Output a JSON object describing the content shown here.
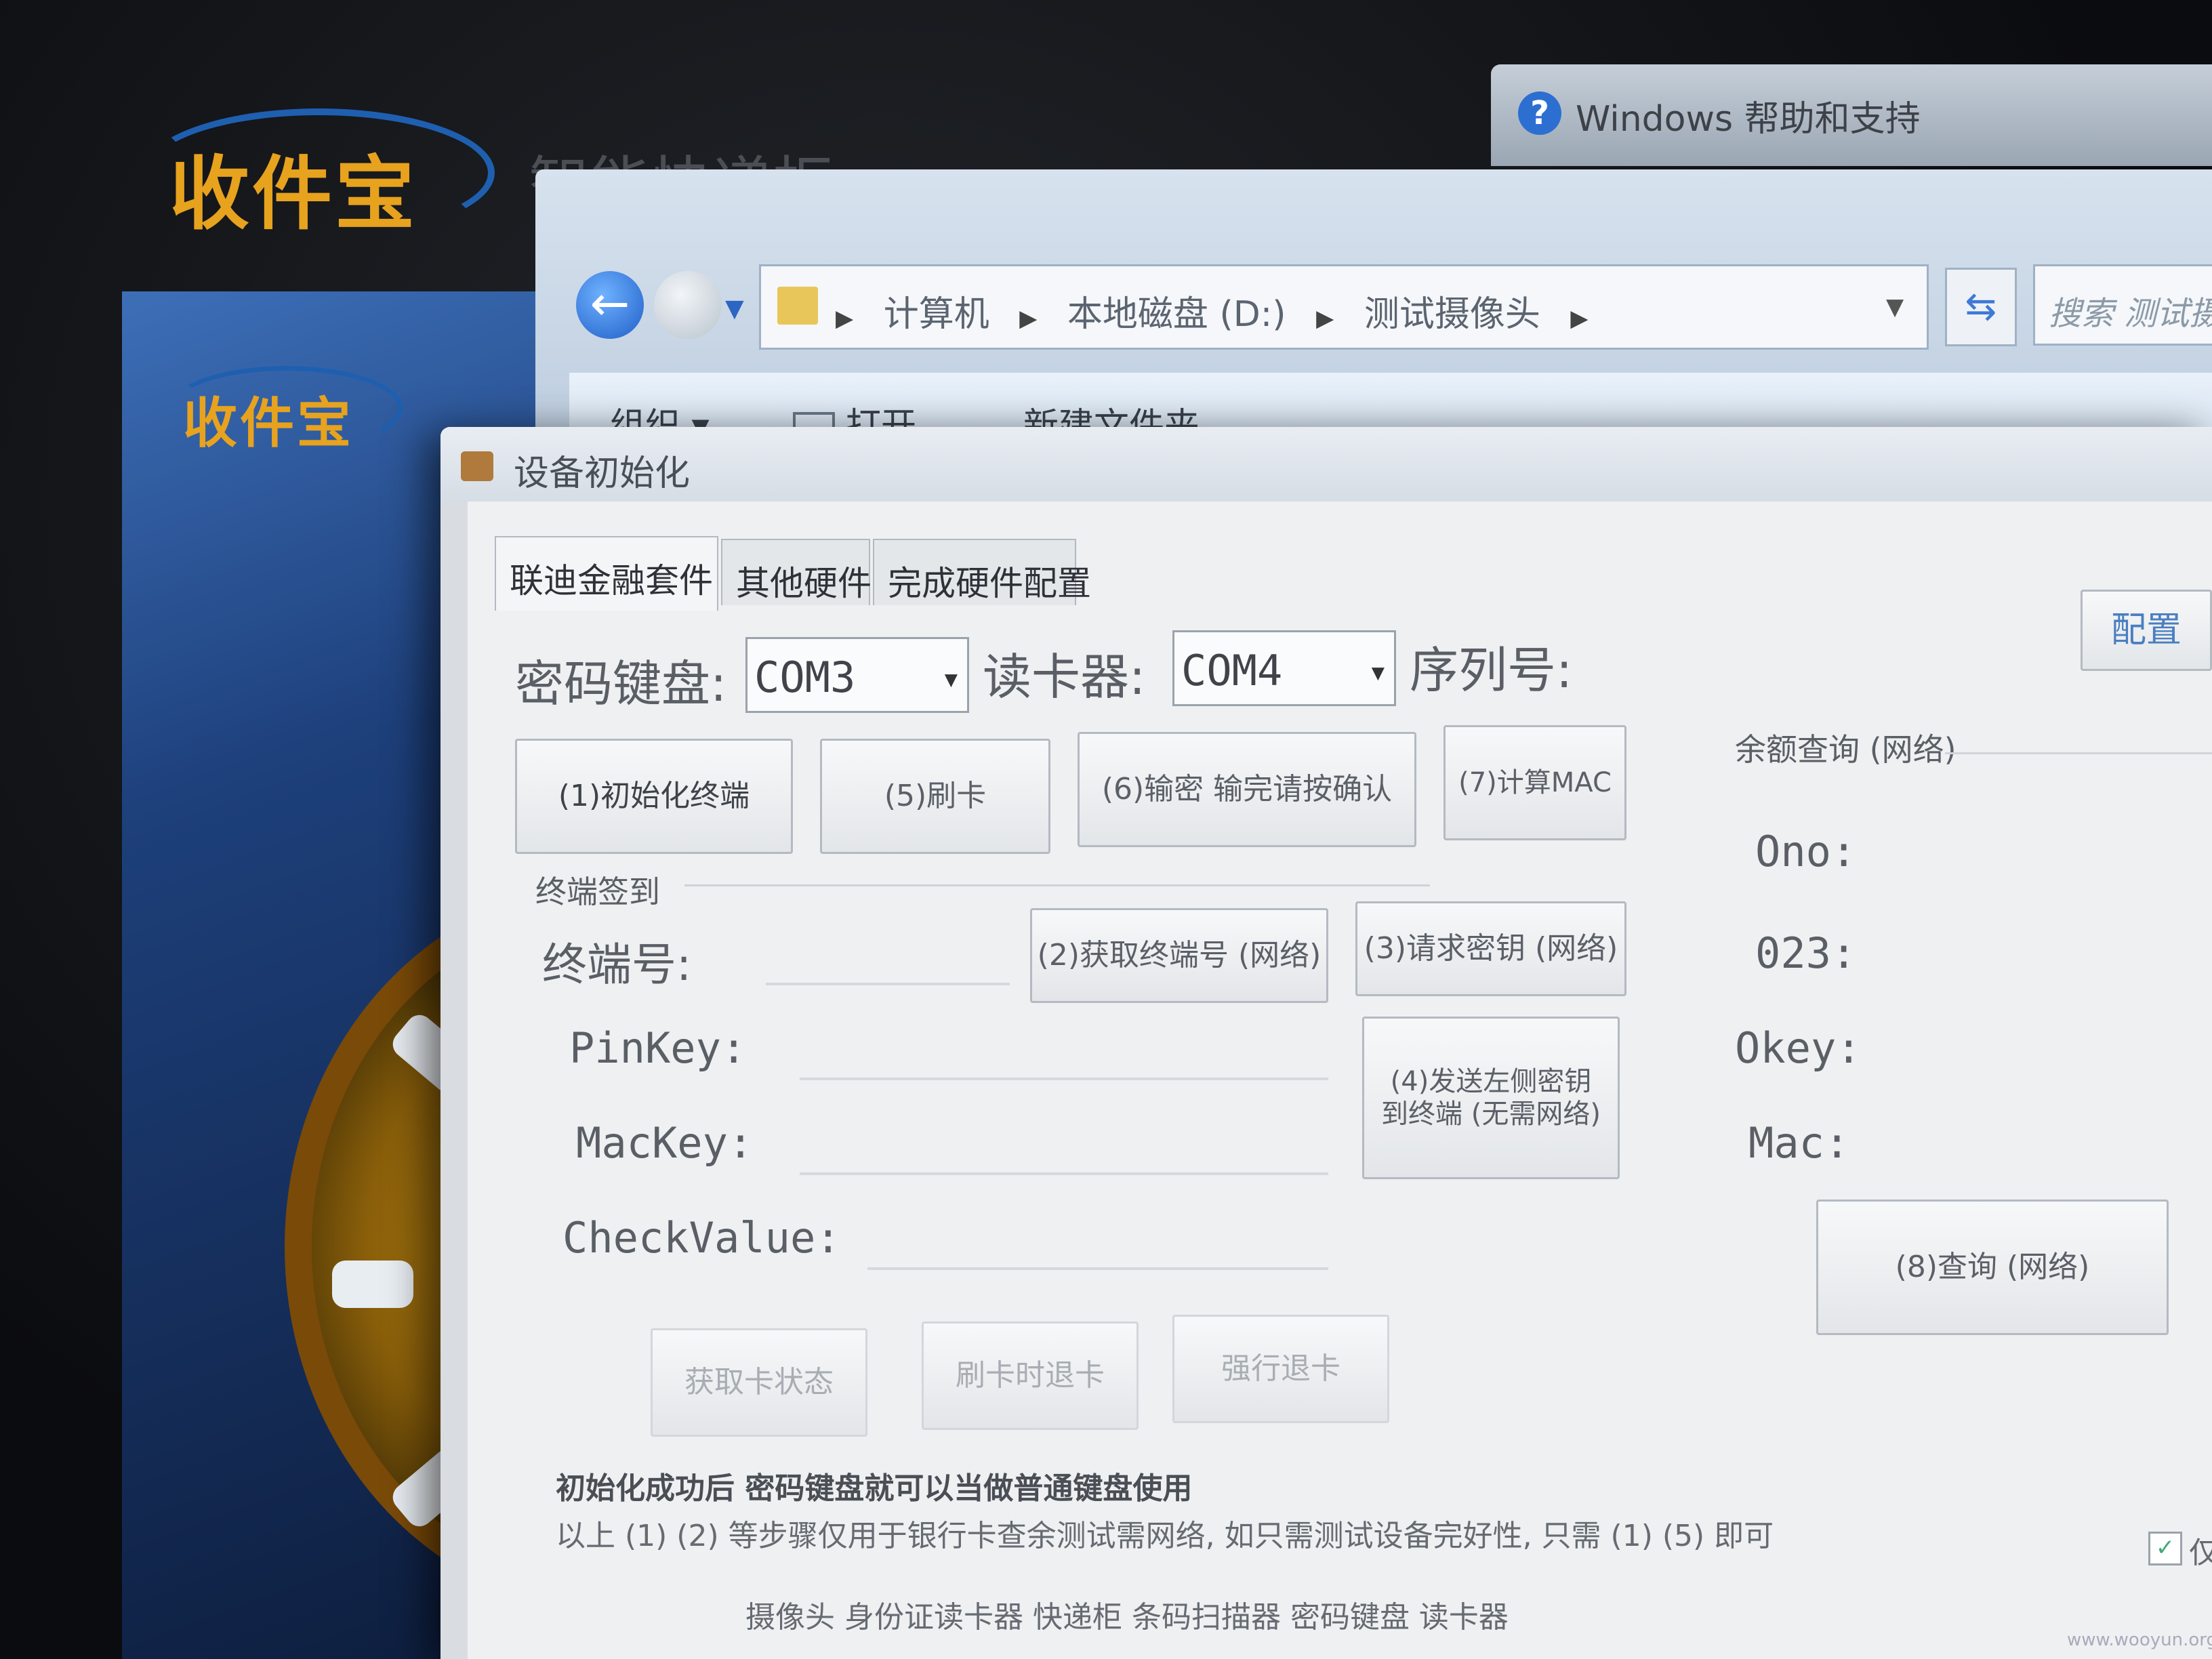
{
  "background_app": {
    "logo_text": "收件宝",
    "logo_text_2": "收件宝",
    "title_partial": "智能快递柜"
  },
  "help_window": {
    "icon": "help-icon",
    "title": "Windows 帮助和支持"
  },
  "explorer": {
    "breadcrumbs": [
      "计算机",
      "本地磁盘 (D:)",
      "测试摄像头"
    ],
    "search_placeholder": "搜索 测试摄像头",
    "toolbar": {
      "organize_label": "组织 ▾",
      "open_label": "打开",
      "new_folder_label": "新建文件夹"
    }
  },
  "dialog": {
    "title": "设备初始化",
    "tabs": [
      {
        "label": "联迪金融套件",
        "active": true
      },
      {
        "label": "其他硬件",
        "active": false
      },
      {
        "label": "完成硬件配置",
        "active": false
      }
    ],
    "config_button": "配置",
    "pinpad_label": "密码键盘:",
    "pinpad_port": "COM3",
    "cardreader_label": "读卡器:",
    "cardreader_port": "COM4",
    "serial_label": "序列号:",
    "buttons": {
      "init_terminal": "(1)初始化终端",
      "swipe_card": "(5)刷卡",
      "enter_pin": "(6)输密  输完请按确认",
      "calc_mac": "(7)计算MAC",
      "get_terminal_no": "(2)获取终端号 (网络)",
      "request_key": "(3)请求密钥 (网络)",
      "send_key_line1": "(4)发送左侧密钥",
      "send_key_line2": "到终端 (无需网络)",
      "query": "(8)查询 (网络)",
      "card_status": "获取卡状态",
      "swipe_eject": "刷卡时退卡",
      "force_eject": "强行退卡"
    },
    "signin_group": "终端签到",
    "terminal_no_label": "终端号:",
    "pinkey_label": "PinKey:",
    "mackey_label": "MacKey:",
    "checkvalue_label": "CheckValue:",
    "balance_group": "余额查询 (网络)",
    "ono_label": "Ono:",
    "o23_label": "023:",
    "okey_label": "Okey:",
    "mac_label": "Mac:",
    "note_bold": "初始化成功后 密码键盘就可以当做普通键盘使用",
    "note_line": "以上 (1)  (2) 等步骤仅用于银行卡查余测试需网络, 如只需测试设备完好性, 只需 (1)  (5) 即可",
    "checkbox_label": "仅测试",
    "hardware_line": "摄像头 身份证读卡器 快递柜 条码扫描器  密码键盘  读卡器"
  },
  "watermark": "www.wooyun.org"
}
